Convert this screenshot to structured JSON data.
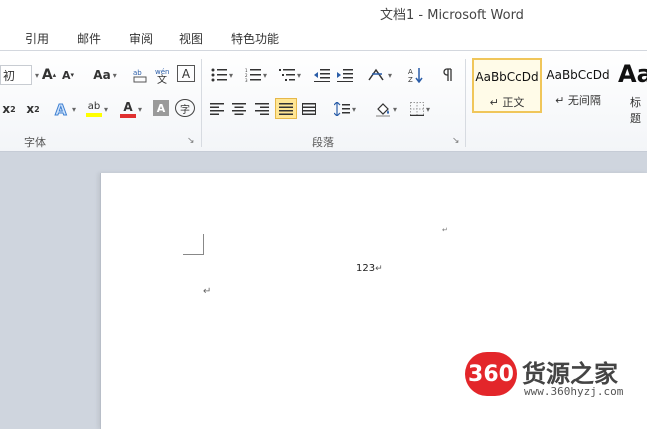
{
  "window": {
    "title": "文档1 - Microsoft Word"
  },
  "tabs": [
    "引用",
    "邮件",
    "审阅",
    "视图",
    "特色功能"
  ],
  "font_group": {
    "label": "字体",
    "font_size_partial": "初",
    "grow_font": "A",
    "shrink_font": "A",
    "change_case": "Aa",
    "clear_format": "A",
    "highlight_label": "ab",
    "font_color_label": "A",
    "char_shading": "A",
    "enclose_char": "字",
    "subscript": "x",
    "subscript_mark": "2",
    "superscript": "x",
    "superscript_mark": "2"
  },
  "paragraph_group": {
    "label": "段落"
  },
  "styles_group": {
    "styles": [
      {
        "sample": "AaBbCcDd",
        "name": "↵ 正文"
      },
      {
        "sample": "AaBbCcDd",
        "name": "↵ 无间隔"
      }
    ],
    "large_sample": "Aa",
    "large_name": "标题"
  },
  "document": {
    "line1": "123",
    "para_mark": "↵",
    "para_mark2": "↵",
    "tiny_mark": "↵"
  },
  "watermark": {
    "logo_text": "360",
    "brand": "货源之家",
    "url": "www.360hyzj.com"
  },
  "colors": {
    "highlight_yellow": "#ffff00",
    "font_red": "#e03030",
    "accent_selected": "#ffe694",
    "watermark_red": "#e3262a"
  }
}
